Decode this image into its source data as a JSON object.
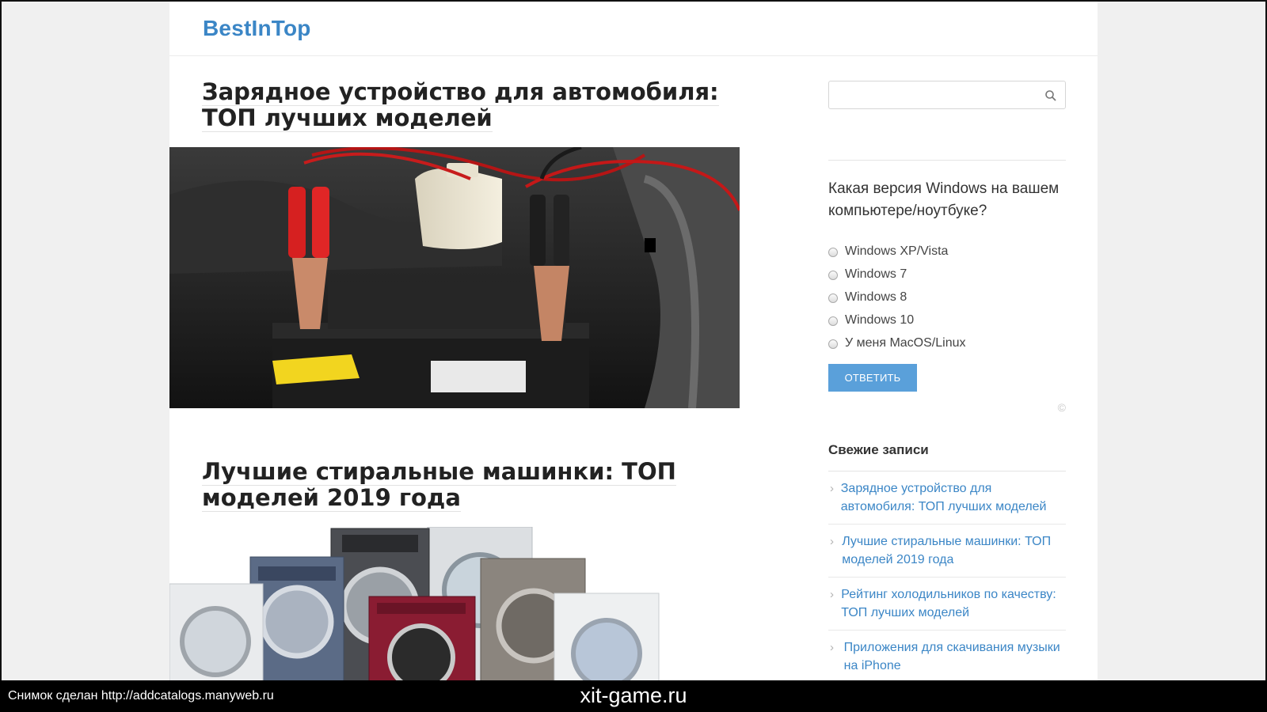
{
  "site": {
    "logo": "BestInTop"
  },
  "posts": [
    {
      "title": "Зарядное устройство для автомобиля: ТОП лучших моделей"
    },
    {
      "title": "Лучшие стиральные машинки: ТОП моделей 2019 года"
    }
  ],
  "sidebar": {
    "search": {
      "value": "",
      "placeholder": ""
    },
    "poll": {
      "question": "Какая версия Windows на вашем компьютере/ноутбуке?",
      "options": [
        "Windows XP/Vista",
        "Windows 7",
        "Windows 8",
        "Windows 10",
        "У меня MacOS/Linux"
      ],
      "button": "ОТВЕТИТЬ",
      "copyright": "©"
    },
    "recent": {
      "title": "Свежие записи",
      "items": [
        "Зарядное устройство для автомобиля: ТОП лучших моделей",
        "Лучшие стиральные машинки: ТОП моделей 2019 года",
        "Рейтинг холодильников по качеству: ТОП лучших моделей",
        "Приложения для скачивания музыки на iPhone"
      ],
      "chevron": "›"
    }
  },
  "footer": {
    "left": "Снимок сделан http://addcatalogs.manyweb.ru",
    "center": "xit-game.ru"
  },
  "colors": {
    "accent": "#3b86c6",
    "button": "#5aa0da",
    "footer_bg": "#000000"
  }
}
